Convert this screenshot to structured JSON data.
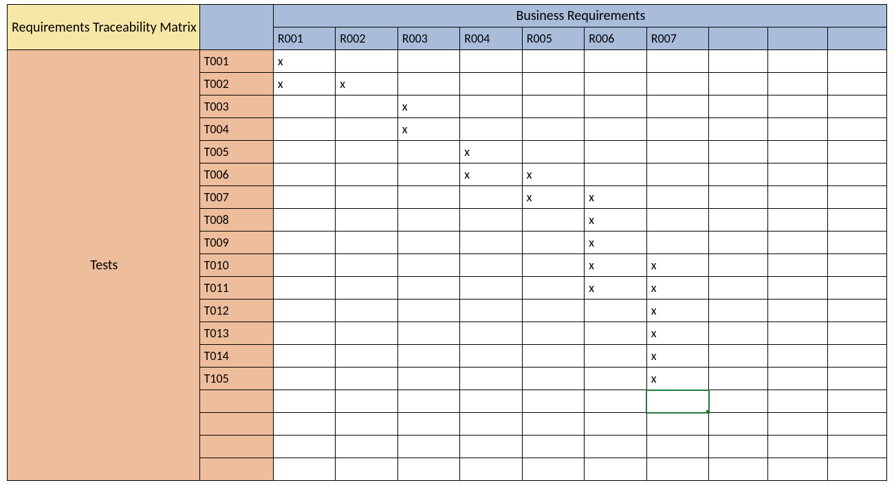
{
  "title_corner": "Requirements Traceability Matrix",
  "col_group_title": "Business Requirements",
  "row_group_title": "Tests",
  "requirement_headers": [
    "R001",
    "R002",
    "R003",
    "R004",
    "R005",
    "R006",
    "R007",
    "",
    "",
    ""
  ],
  "test_rows": [
    "T001",
    "T002",
    "T003",
    "T004",
    "T005",
    "T006",
    "T007",
    "T008",
    "T009",
    "T010",
    "T011",
    "T012",
    "T013",
    "T014",
    "T105",
    "",
    "",
    "",
    ""
  ],
  "mark_char": "x",
  "matrix": [
    [
      "x",
      "",
      "",
      "",
      "",
      "",
      "",
      "",
      "",
      ""
    ],
    [
      "x",
      "x",
      "",
      "",
      "",
      "",
      "",
      "",
      "",
      ""
    ],
    [
      "",
      "",
      "x",
      "",
      "",
      "",
      "",
      "",
      "",
      ""
    ],
    [
      "",
      "",
      "x",
      "",
      "",
      "",
      "",
      "",
      "",
      ""
    ],
    [
      "",
      "",
      "",
      "x",
      "",
      "",
      "",
      "",
      "",
      ""
    ],
    [
      "",
      "",
      "",
      "x",
      "x",
      "",
      "",
      "",
      "",
      ""
    ],
    [
      "",
      "",
      "",
      "",
      "x",
      "x",
      "",
      "",
      "",
      ""
    ],
    [
      "",
      "",
      "",
      "",
      "",
      "x",
      "",
      "",
      "",
      ""
    ],
    [
      "",
      "",
      "",
      "",
      "",
      "x",
      "",
      "",
      "",
      ""
    ],
    [
      "",
      "",
      "",
      "",
      "",
      "x",
      "x",
      "",
      "",
      ""
    ],
    [
      "",
      "",
      "",
      "",
      "",
      "x",
      "x",
      "",
      "",
      ""
    ],
    [
      "",
      "",
      "",
      "",
      "",
      "",
      "x",
      "",
      "",
      ""
    ],
    [
      "",
      "",
      "",
      "",
      "",
      "",
      "x",
      "",
      "",
      ""
    ],
    [
      "",
      "",
      "",
      "",
      "",
      "",
      "x",
      "",
      "",
      ""
    ],
    [
      "",
      "",
      "",
      "",
      "",
      "",
      "x",
      "",
      "",
      ""
    ],
    [
      "",
      "",
      "",
      "",
      "",
      "",
      "",
      "",
      "",
      ""
    ],
    [
      "",
      "",
      "",
      "",
      "",
      "",
      "",
      "",
      "",
      ""
    ],
    [
      "",
      "",
      "",
      "",
      "",
      "",
      "",
      "",
      "",
      ""
    ],
    [
      "",
      "",
      "",
      "",
      "",
      "",
      "",
      "",
      "",
      ""
    ]
  ],
  "selected_cell": {
    "row": 15,
    "col": 6
  },
  "chart_data": {
    "type": "table",
    "title": "Requirements Traceability Matrix",
    "columns": [
      "R001",
      "R002",
      "R003",
      "R004",
      "R005",
      "R006",
      "R007"
    ],
    "rows": [
      "T001",
      "T002",
      "T003",
      "T004",
      "T005",
      "T006",
      "T007",
      "T008",
      "T009",
      "T010",
      "T011",
      "T012",
      "T013",
      "T014",
      "T105"
    ],
    "marks": {
      "T001": [
        "R001"
      ],
      "T002": [
        "R001",
        "R002"
      ],
      "T003": [
        "R003"
      ],
      "T004": [
        "R003"
      ],
      "T005": [
        "R004"
      ],
      "T006": [
        "R004",
        "R005"
      ],
      "T007": [
        "R005",
        "R006"
      ],
      "T008": [
        "R006"
      ],
      "T009": [
        "R006"
      ],
      "T010": [
        "R006",
        "R007"
      ],
      "T011": [
        "R006",
        "R007"
      ],
      "T012": [
        "R007"
      ],
      "T013": [
        "R007"
      ],
      "T014": [
        "R007"
      ],
      "T105": [
        "R007"
      ]
    }
  }
}
